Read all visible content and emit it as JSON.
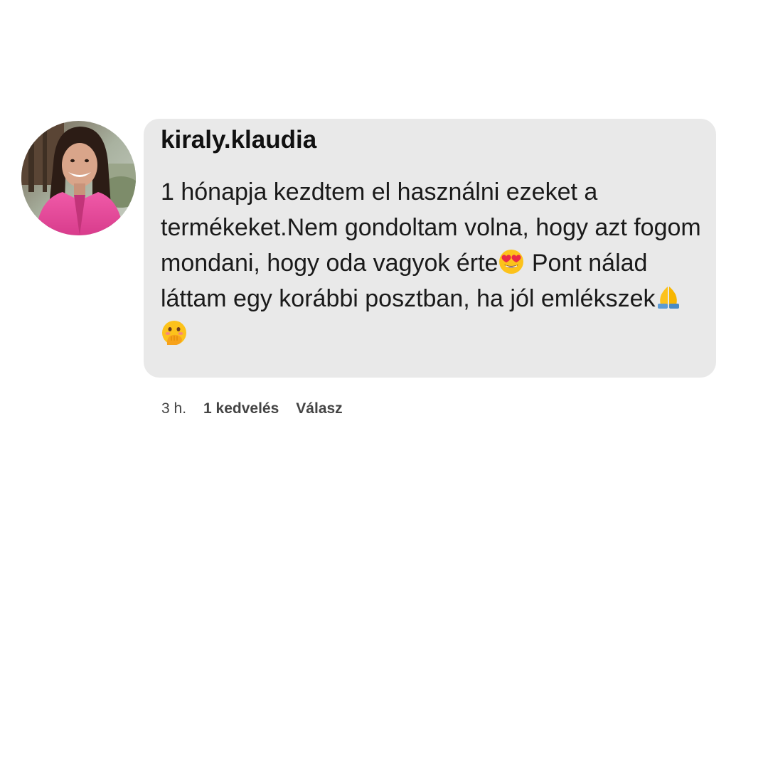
{
  "comment": {
    "username": "kiraly.klaudia",
    "text_parts": [
      "1 hónapja kezdtem el használni ezeket a termékeket.Nem gondoltam volna, hogy azt fogom mondani, hogy oda vagyok érte",
      " Pont nálad láttam egy korábbi posztban, ha jól emlékszek"
    ],
    "emojis": [
      "heart-eyes-emoji",
      "folded-hands-emoji",
      "hand-over-mouth-emoji"
    ]
  },
  "meta": {
    "time": "3 h.",
    "likes": "1 kedvelés",
    "reply": "Válasz"
  },
  "colors": {
    "bubble_bg": "#e9e9e9",
    "text": "#1a1a1a",
    "meta_text": "#444444",
    "avatar_jacket": "#e84c9a"
  }
}
